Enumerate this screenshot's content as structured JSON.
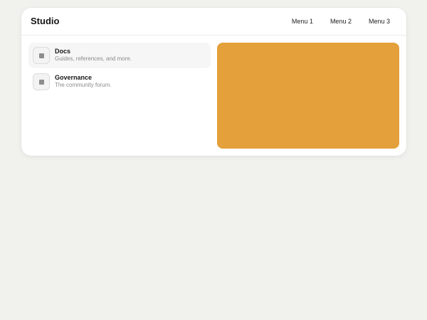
{
  "header": {
    "brand": "Studio",
    "menu": [
      {
        "label": "Menu 1"
      },
      {
        "label": "Menu 2"
      },
      {
        "label": "Menu 3"
      }
    ]
  },
  "list": {
    "items": [
      {
        "title": "Docs",
        "description": "Guides, references, and more.",
        "icon": "square-icon",
        "active": true
      },
      {
        "title": "Governance",
        "description": "The community forum.",
        "icon": "square-icon",
        "active": false
      }
    ]
  },
  "feature": {
    "color": "#e4a03a"
  },
  "colors": {
    "background": "#f1f1ee",
    "card": "#ffffff",
    "accent": "#e4a03a"
  }
}
